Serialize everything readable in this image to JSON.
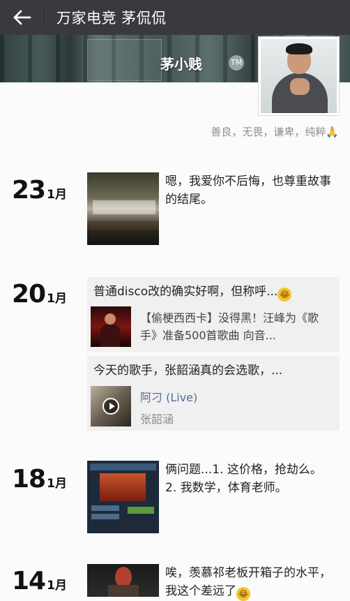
{
  "header": {
    "back_label": "←",
    "title": "万家电竞 茅侃侃"
  },
  "profile": {
    "nickname": "茅小贱",
    "nick_badge": "TM",
    "signature": "善良，无畏，谦卑，纯粹🙏"
  },
  "posts": [
    {
      "day": "23",
      "month": "1月",
      "text": "嗯，我爱你不后悔，也尊重故事的结尾。"
    },
    {
      "day": "20",
      "month": "1月",
      "shares": [
        {
          "text": "普通disco改的确实好啊，但称呼...",
          "emoji": "😂",
          "link_title": "【偷梗西西卡】没得黑！汪峰为《歌手》准备500首歌曲 向音..."
        },
        {
          "text": "今天的歌手，张韶涵真的会选歌，...",
          "song_title": "阿刁 (Live)",
          "song_artist": "张韶涵"
        }
      ]
    },
    {
      "day": "18",
      "month": "1月",
      "text": "俩问题...1. 这价格，抢劫么。2. 我数学，体育老师。"
    },
    {
      "day": "14",
      "month": "1月",
      "text": "唉，羡慕祁老板开箱子的水平，我这个差远了",
      "emoji": "😂"
    }
  ]
}
